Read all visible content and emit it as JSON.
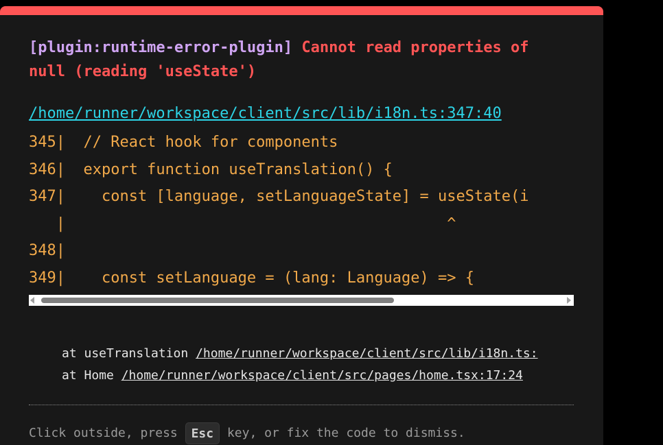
{
  "error": {
    "plugin_label": "[plugin:runtime-error-plugin]",
    "message": "Cannot read properties of null (reading 'useState')",
    "file_link": "/home/runner/workspace/client/src/lib/i18n.ts:347:40",
    "code_frame": [
      "345|  // React hook for components",
      "346|  export function useTranslation() {",
      "347|    const [language, setLanguageState] = useState(i",
      "   |                                          ^",
      "348|",
      "349|    const setLanguage = (lang: Language) => {"
    ],
    "stack": [
      {
        "prefix": "at useTranslation ",
        "link": "/home/runner/workspace/client/src/lib/i18n.ts:"
      },
      {
        "prefix": "at Home ",
        "link": "/home/runner/workspace/client/src/pages/home.tsx:17:24"
      }
    ]
  },
  "tip": {
    "before": "Click outside, press ",
    "key": "Esc",
    "after": " key, or fix the code to dismiss."
  },
  "colors": {
    "accent_bar": "#ff5555",
    "plugin": "#cfa4f2",
    "error": "#ff5555",
    "link": "#2dd4e6",
    "code": "#f1a94a",
    "background": "#181818"
  }
}
